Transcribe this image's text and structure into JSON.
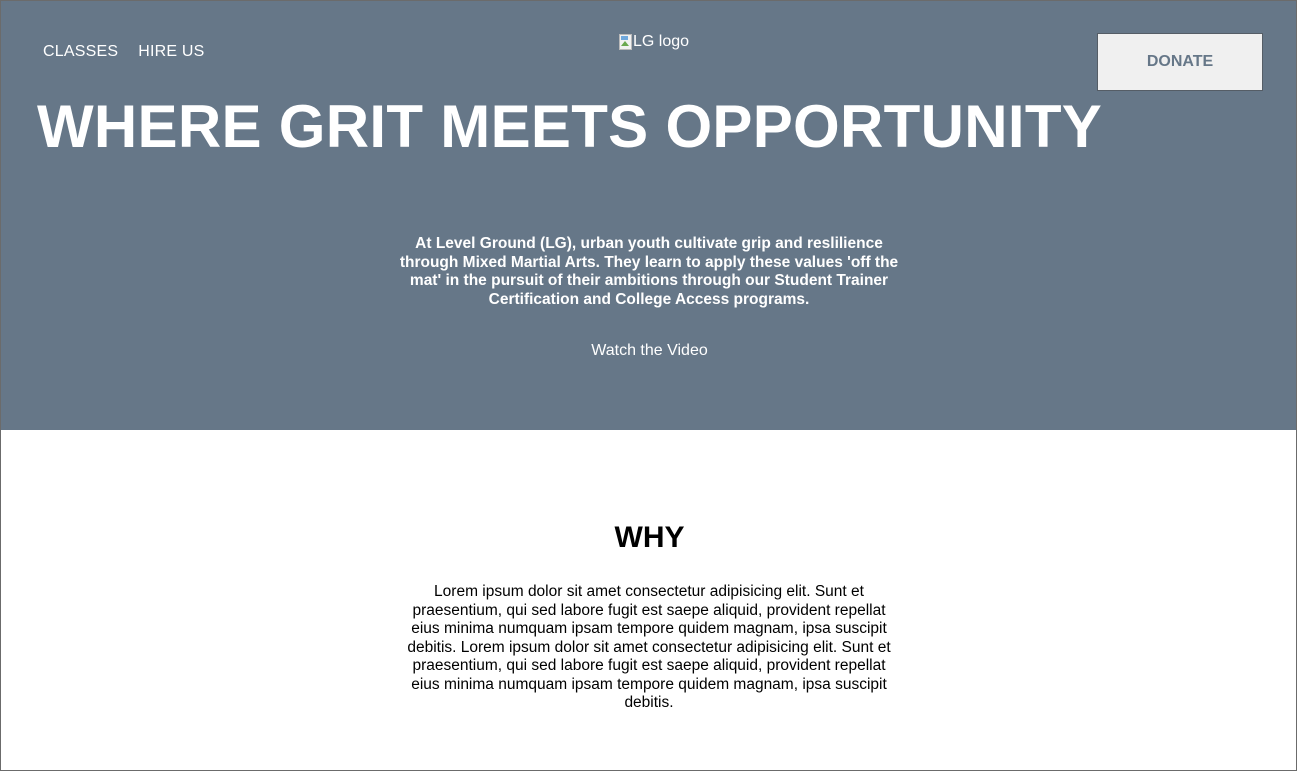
{
  "nav": {
    "items": [
      {
        "label": "CLASSES"
      },
      {
        "label": "HIRE US"
      }
    ]
  },
  "logo": {
    "alt_text": "LG logo",
    "icon": "broken-image-icon"
  },
  "header": {
    "donate_label": "DONATE"
  },
  "hero": {
    "headline": "WHERE GRIT MEETS OPPORTUNITY",
    "mission": "At Level Ground (LG), urban youth cultivate grip and reslilience through Mixed Martial Arts. They learn to apply these values 'off the mat' in the pursuit of their ambitions through our Student Trainer Certification and College Access programs.",
    "video_link": "Watch the Video"
  },
  "why": {
    "title": "WHY",
    "body": "Lorem ipsum dolor sit amet consectetur adipisicing elit. Sunt et praesentium, qui sed labore fugit est saepe aliquid, provident repellat eius minima numquam ipsam tempore quidem magnam, ipsa suscipit debitis. Lorem ipsum dolor sit amet consectetur adipisicing elit. Sunt et praesentium, qui sed labore fugit est saepe aliquid, provident repellat eius minima numquam ipsam tempore quidem magnam, ipsa suscipit debitis."
  },
  "colors": {
    "hero_background": "#667788",
    "donate_text": "#667788",
    "donate_background": "#f0f0f0",
    "text_light": "#ffffff",
    "text_dark": "#000000"
  }
}
